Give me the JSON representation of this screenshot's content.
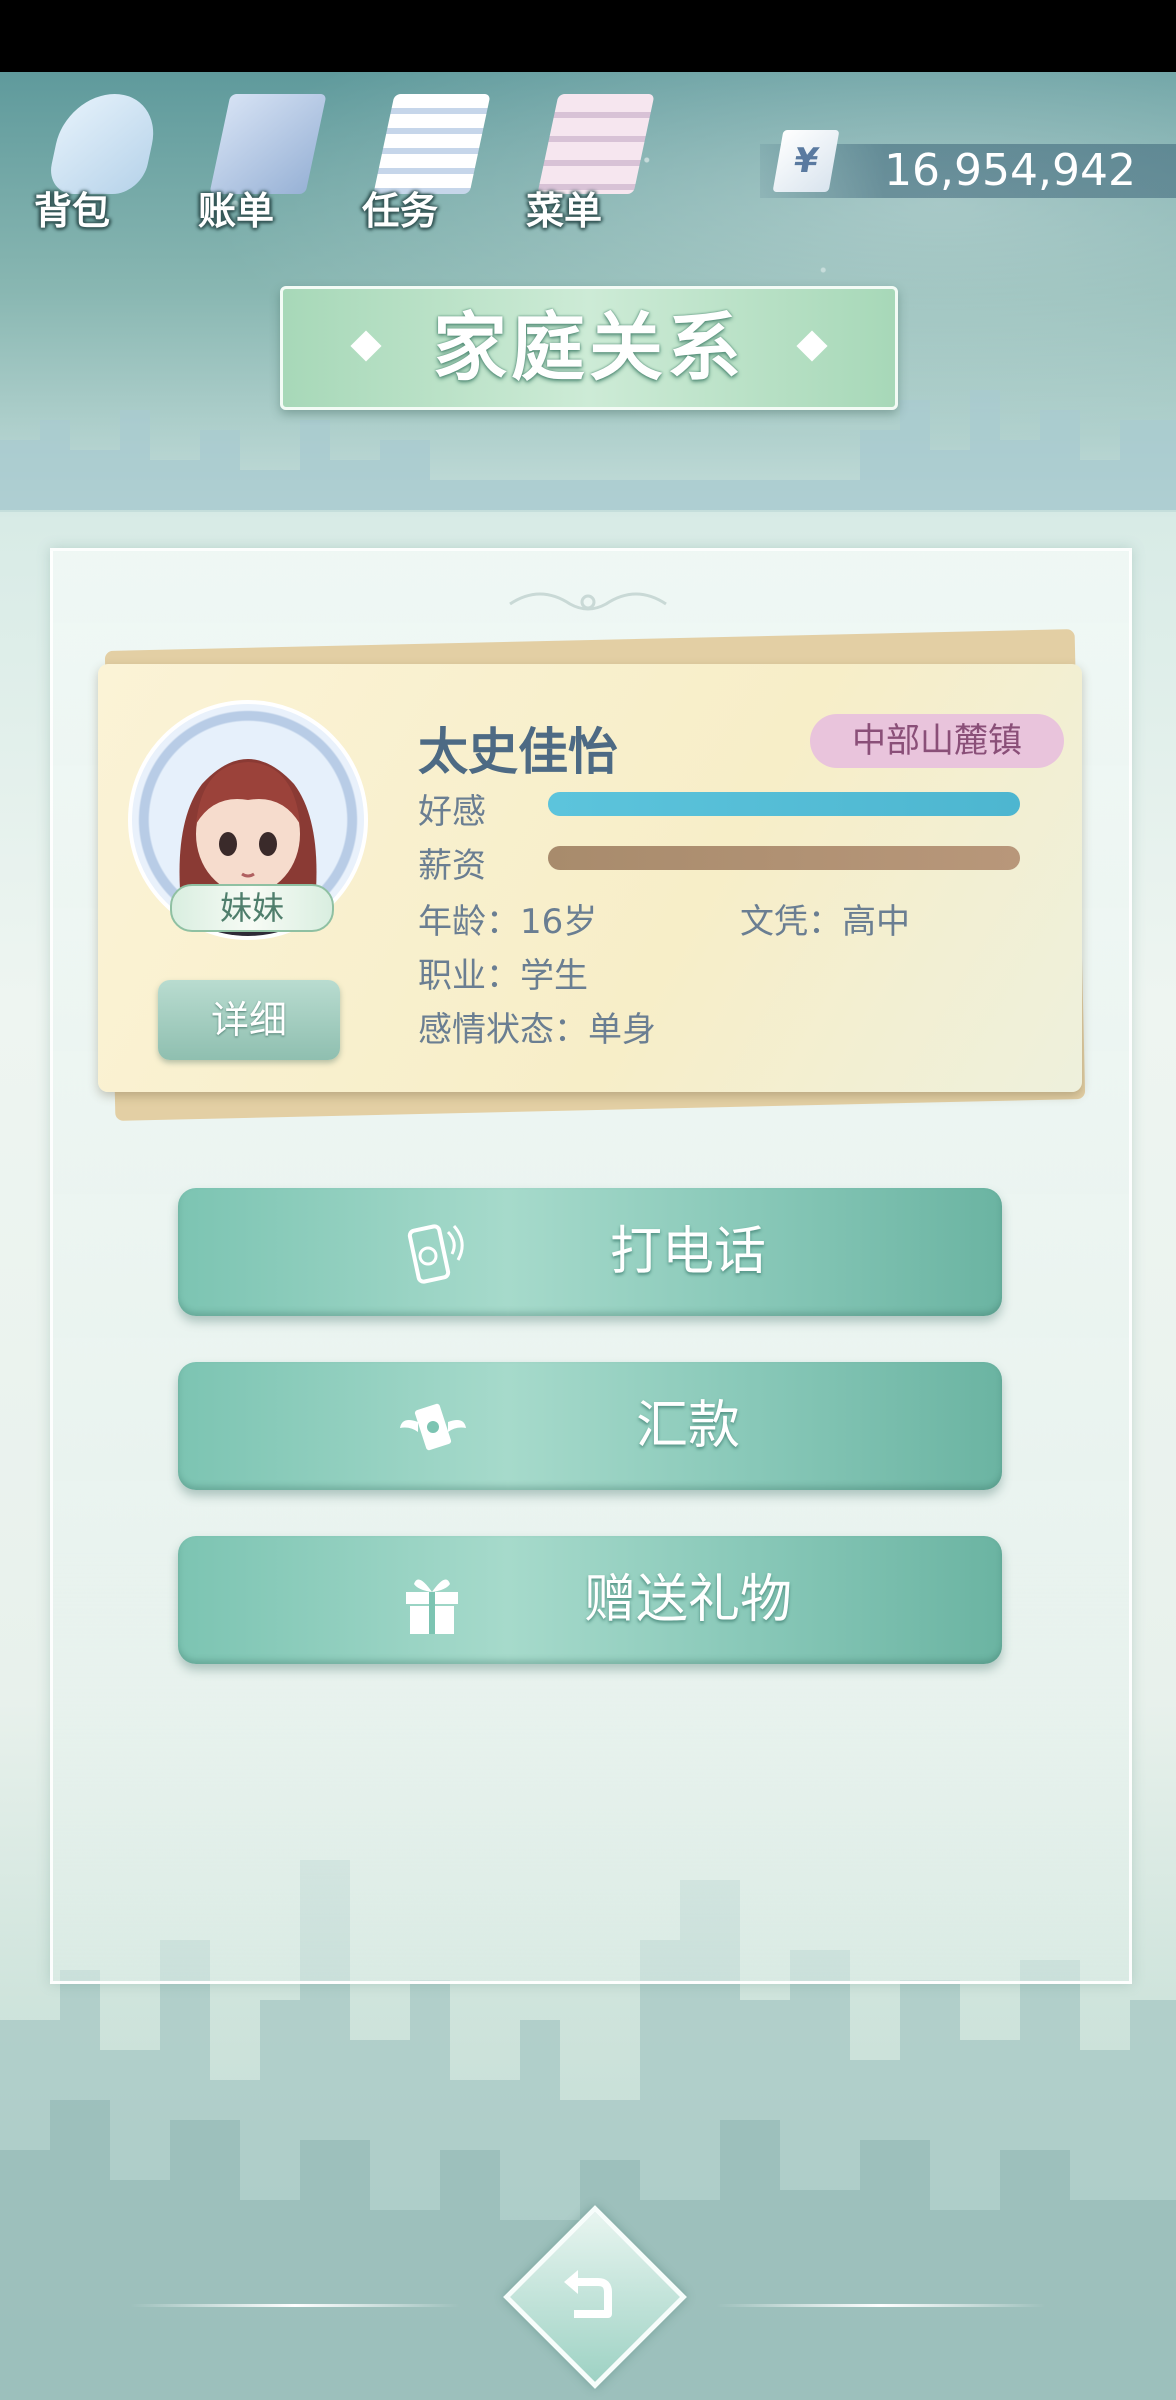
{
  "top_menu": {
    "bag": "背包",
    "bills": "账单",
    "tasks": "任务",
    "menu": "菜单"
  },
  "money": {
    "currency_symbol": "¥",
    "amount": "16,954,942"
  },
  "page_title": "家庭关系",
  "character": {
    "name": "太史佳怡",
    "region": "中部山麓镇",
    "relation": "妹妹",
    "detail_button": "详细",
    "favor_label": "好感",
    "favor_level": 1.0,
    "salary_label": "薪资",
    "salary_level": 1.0,
    "age": "年龄：16岁",
    "education": "文凭：高中",
    "occupation": "职业：学生",
    "relationship_status": "感情状态：单身"
  },
  "actions": {
    "call": "打电话",
    "remit": "汇款",
    "gift": "赠送礼物"
  },
  "colors": {
    "favor_bar": "#4db6d0",
    "salary_bar": "#a88b6c",
    "action_button": "#88c8b8",
    "region_badge": "#e9c4dc"
  }
}
